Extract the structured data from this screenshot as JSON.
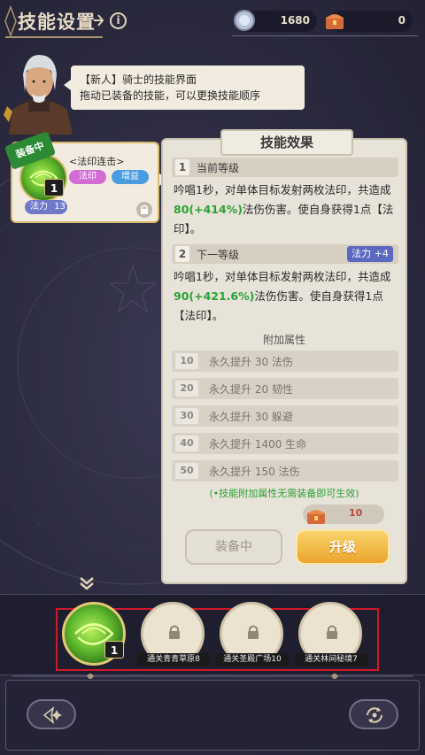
{
  "header": {
    "title": "技能设置",
    "info_icon": "i",
    "resources": [
      {
        "icon": "silver-coin-icon",
        "value": "1680"
      },
      {
        "icon": "treasure-chest-icon",
        "value": "0"
      }
    ]
  },
  "npc": {
    "avatar": "knight-avatar",
    "message_line1": "【新人】骑士的技能界面",
    "message_line2": "拖动已装备的技能，可以更换技能顺序"
  },
  "skill_card": {
    "equipped_tag": "装备中",
    "name": "<法印连击>",
    "tags": [
      {
        "label": "法印",
        "color": "#d36bd4"
      },
      {
        "label": "增益",
        "color": "#4a9be0"
      }
    ],
    "mana_label": "法力",
    "mana_value": "13",
    "level": "1"
  },
  "effect_panel": {
    "title": "技能效果",
    "current": {
      "num": "1",
      "label": "当前等级",
      "desc_a": "吟唱1秒，对单体目标发射两枚法印，共造成",
      "desc_value": "80(+414%)",
      "desc_b": "法伤伤害。使自身获得1点【法印】。"
    },
    "next": {
      "num": "2",
      "label": "下一等级",
      "badge": "法力 +4",
      "desc_a": "吟唱1秒，对单体目标发射两枚法印，共造成",
      "desc_value": "90(+421.6%)",
      "desc_b": "法伤伤害。使自身获得1点【法印】。"
    },
    "extra_title": "附加属性",
    "extra_attrs": [
      {
        "level": "10",
        "text": "永久提升 30 法伤"
      },
      {
        "level": "20",
        "text": "永久提升 20 韧性"
      },
      {
        "level": "30",
        "text": "永久提升 30 躲避"
      },
      {
        "level": "40",
        "text": "永久提升 1400 生命"
      },
      {
        "level": "50",
        "text": "永久提升 150 法伤"
      }
    ],
    "note": "(•技能附加属性无需装备即可生效)",
    "cost_value": "10",
    "equip_button": "装备中",
    "upgrade_button": "升级"
  },
  "slots": {
    "active_level": "1",
    "locked": [
      {
        "label": "通关青青草原8"
      },
      {
        "label": "通关圣殿广场10"
      },
      {
        "label": "通关林间秘境7"
      }
    ]
  },
  "colors": {
    "background": "#2b2a3f",
    "panel": "#e8e3d9",
    "accent_gold": "#d6ba6a",
    "upgrade": "#f0b53c",
    "highlight_green": "#2aa135",
    "selection_box": "#d0182a"
  }
}
